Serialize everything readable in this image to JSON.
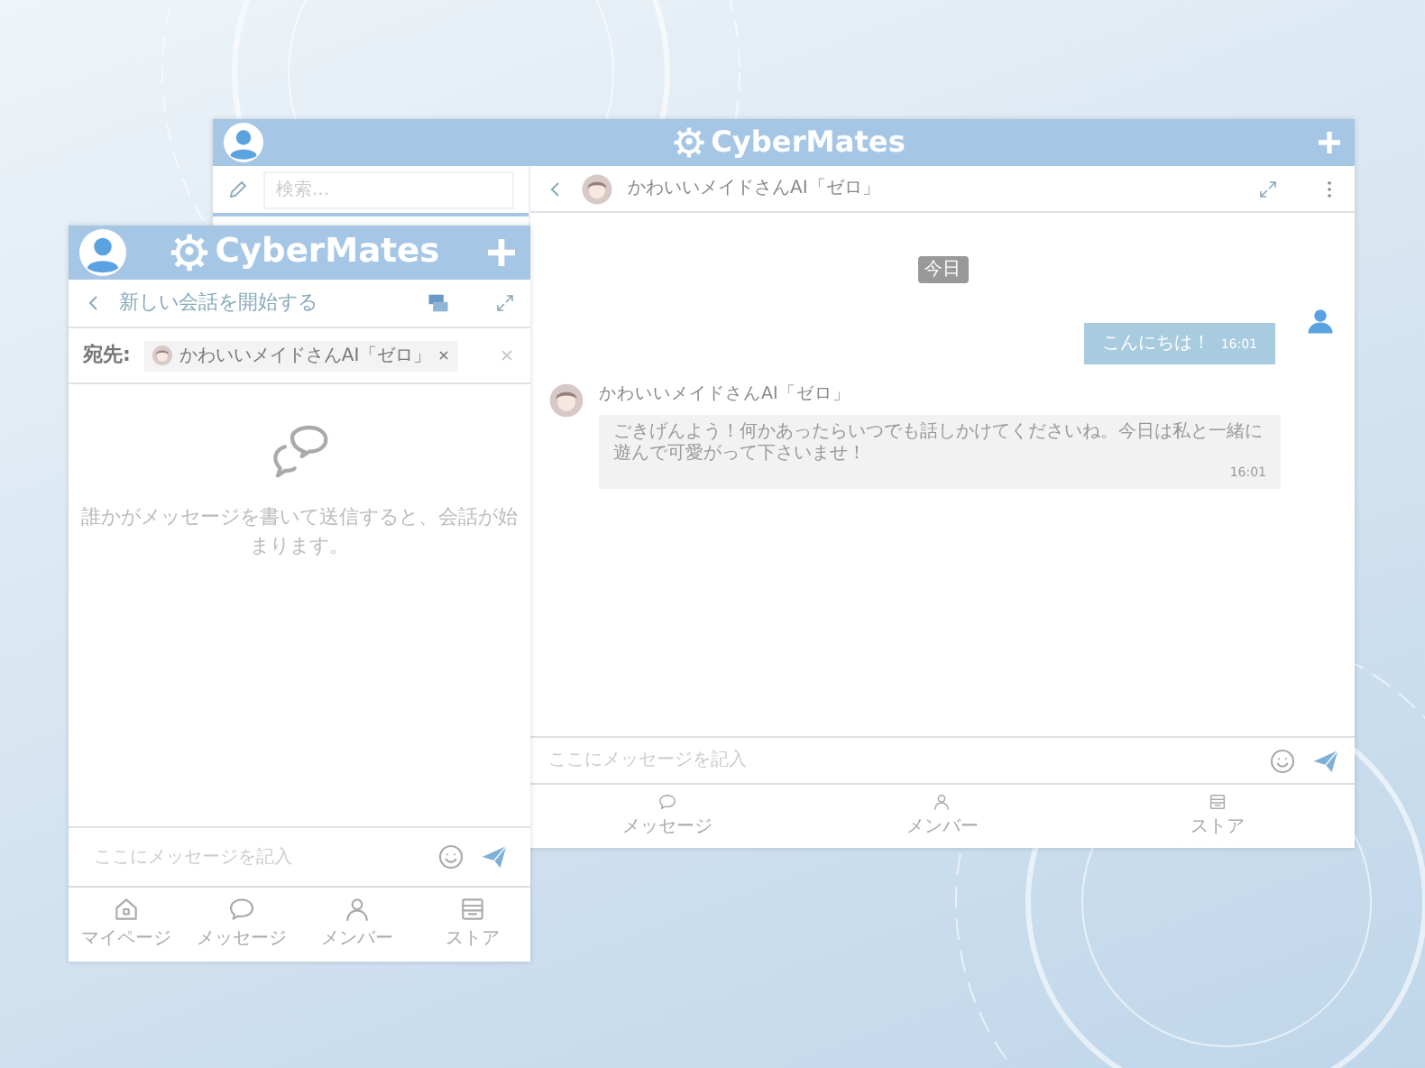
{
  "main_window": {
    "title": "CyberMates",
    "search": {
      "placeholder": "検索..."
    },
    "chat": {
      "contact_name": "かわいいメイドさんAI「ゼロ」",
      "date_label": "今日",
      "messages": [
        {
          "kind": "sent",
          "text": "こんにちは！",
          "time": "16:01"
        },
        {
          "kind": "received",
          "sender": "かわいいメイドさんAI「ゼロ」",
          "text": "ごきげんよう！何かあったらいつでも話しかけてくださいね。今日は私と一緒に遊んで可愛がって下さいませ！",
          "time": "16:01"
        }
      ],
      "input": {
        "placeholder": "ここにメッセージを記入"
      }
    },
    "nav": [
      {
        "kind": "chat",
        "label": "メッセージ"
      },
      {
        "kind": "person",
        "label": "メンバー"
      },
      {
        "kind": "store",
        "label": "ストア"
      }
    ]
  },
  "popup_window": {
    "title": "CyberMates",
    "heading": "新しい会話を開始する",
    "recipient": {
      "label": "宛先:",
      "chip": "かわいいメイドさんAI「ゼロ」"
    },
    "empty_text": "誰かがメッセージを書いて送信すると、会話が始まります。",
    "input": {
      "placeholder": "ここにメッセージを記入"
    },
    "nav": [
      {
        "kind": "home",
        "label": "マイページ"
      },
      {
        "kind": "chat",
        "label": "メッセージ"
      },
      {
        "kind": "person",
        "label": "メンバー"
      },
      {
        "kind": "store",
        "label": "ストア"
      }
    ]
  }
}
